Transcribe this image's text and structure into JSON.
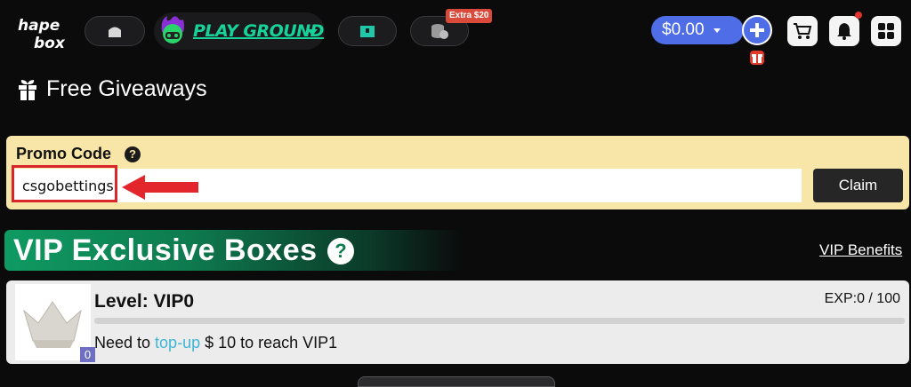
{
  "header": {
    "logo_text": "hapc box",
    "playground_label": "PLAY GROUND",
    "extra_badge": "Extra $20",
    "balance": "$0.00",
    "icons": [
      "home-icon",
      "alien-avatar-icon",
      "box-icon",
      "coins-icon",
      "plus-icon",
      "gift-icon",
      "cart-icon",
      "bell-icon",
      "menu-grid-icon"
    ],
    "colors": {
      "accent": "#4f6de6",
      "playground": "#17d39a",
      "badge": "#d94a3a"
    }
  },
  "giveaways": {
    "title": "Free Giveaways"
  },
  "promo": {
    "label": "Promo Code",
    "help": "?",
    "input_value": "csgobettings",
    "claim_label": "Claim",
    "bg_color": "#f8e6a8"
  },
  "vip": {
    "title": "VIP Exclusive Boxes",
    "help": "?",
    "benefits_link": "VIP Benefits",
    "level_title": "Level: VIP0",
    "level_number": "0",
    "exp_text": "EXP:0 / 100",
    "progress_fraction": 0,
    "need_prefix": "Need to ",
    "need_link": "top-up",
    "need_suffix": " $ 10 to reach VIP1"
  }
}
